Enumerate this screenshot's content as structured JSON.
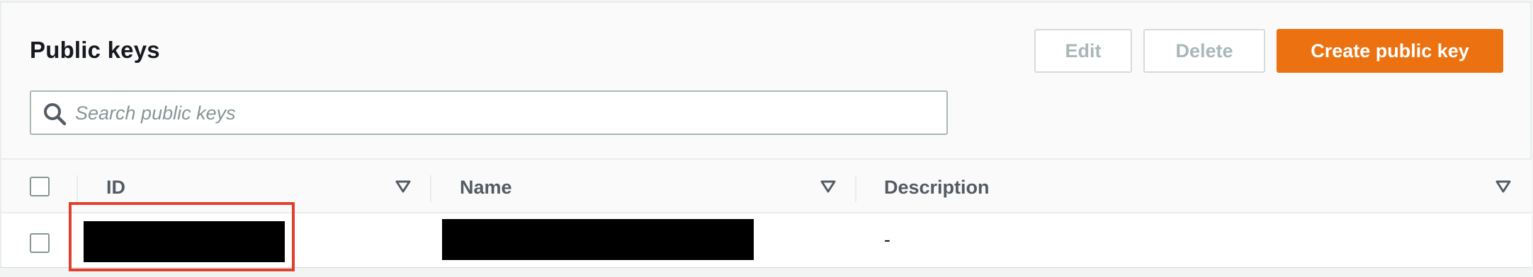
{
  "header": {
    "title": "Public keys"
  },
  "actions": {
    "edit_label": "Edit",
    "delete_label": "Delete",
    "create_label": "Create public key"
  },
  "search": {
    "placeholder": "Search public keys",
    "value": ""
  },
  "table": {
    "columns": [
      {
        "label": "ID"
      },
      {
        "label": "Name"
      },
      {
        "label": "Description"
      }
    ],
    "rows": [
      {
        "id": "",
        "name": "",
        "description": "-",
        "redacted": [
          "id",
          "name"
        ]
      }
    ]
  },
  "colors": {
    "primary": "#ec7211",
    "highlight": "#e0402e"
  },
  "icons": {
    "search": "search-icon",
    "sort": "sort-triangle-icon"
  }
}
